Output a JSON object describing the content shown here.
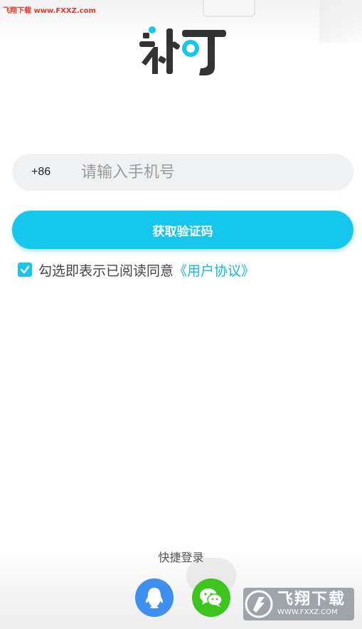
{
  "watermark_top": "飞翔下载 www.FXXZ.com",
  "app": {
    "logo_text": "补丁"
  },
  "login": {
    "country_code": "+86",
    "phone_placeholder": "请输入手机号",
    "get_code_label": "获取验证码",
    "agree_text": "勾选即表示已阅读同意",
    "agreement_link": "《用户协议》",
    "agree_checked": true
  },
  "quick_login": {
    "label": "快捷登录",
    "providers": [
      "qq-icon",
      "wechat-icon"
    ]
  },
  "watermark_bottom": {
    "name": "飞翔下载",
    "url": "WWW.FXXZ.COM"
  },
  "colors": {
    "accent": "#15c7ec",
    "link": "#15b9e6",
    "qq": "#3f8ff0",
    "wechat": "#3cc51f"
  }
}
